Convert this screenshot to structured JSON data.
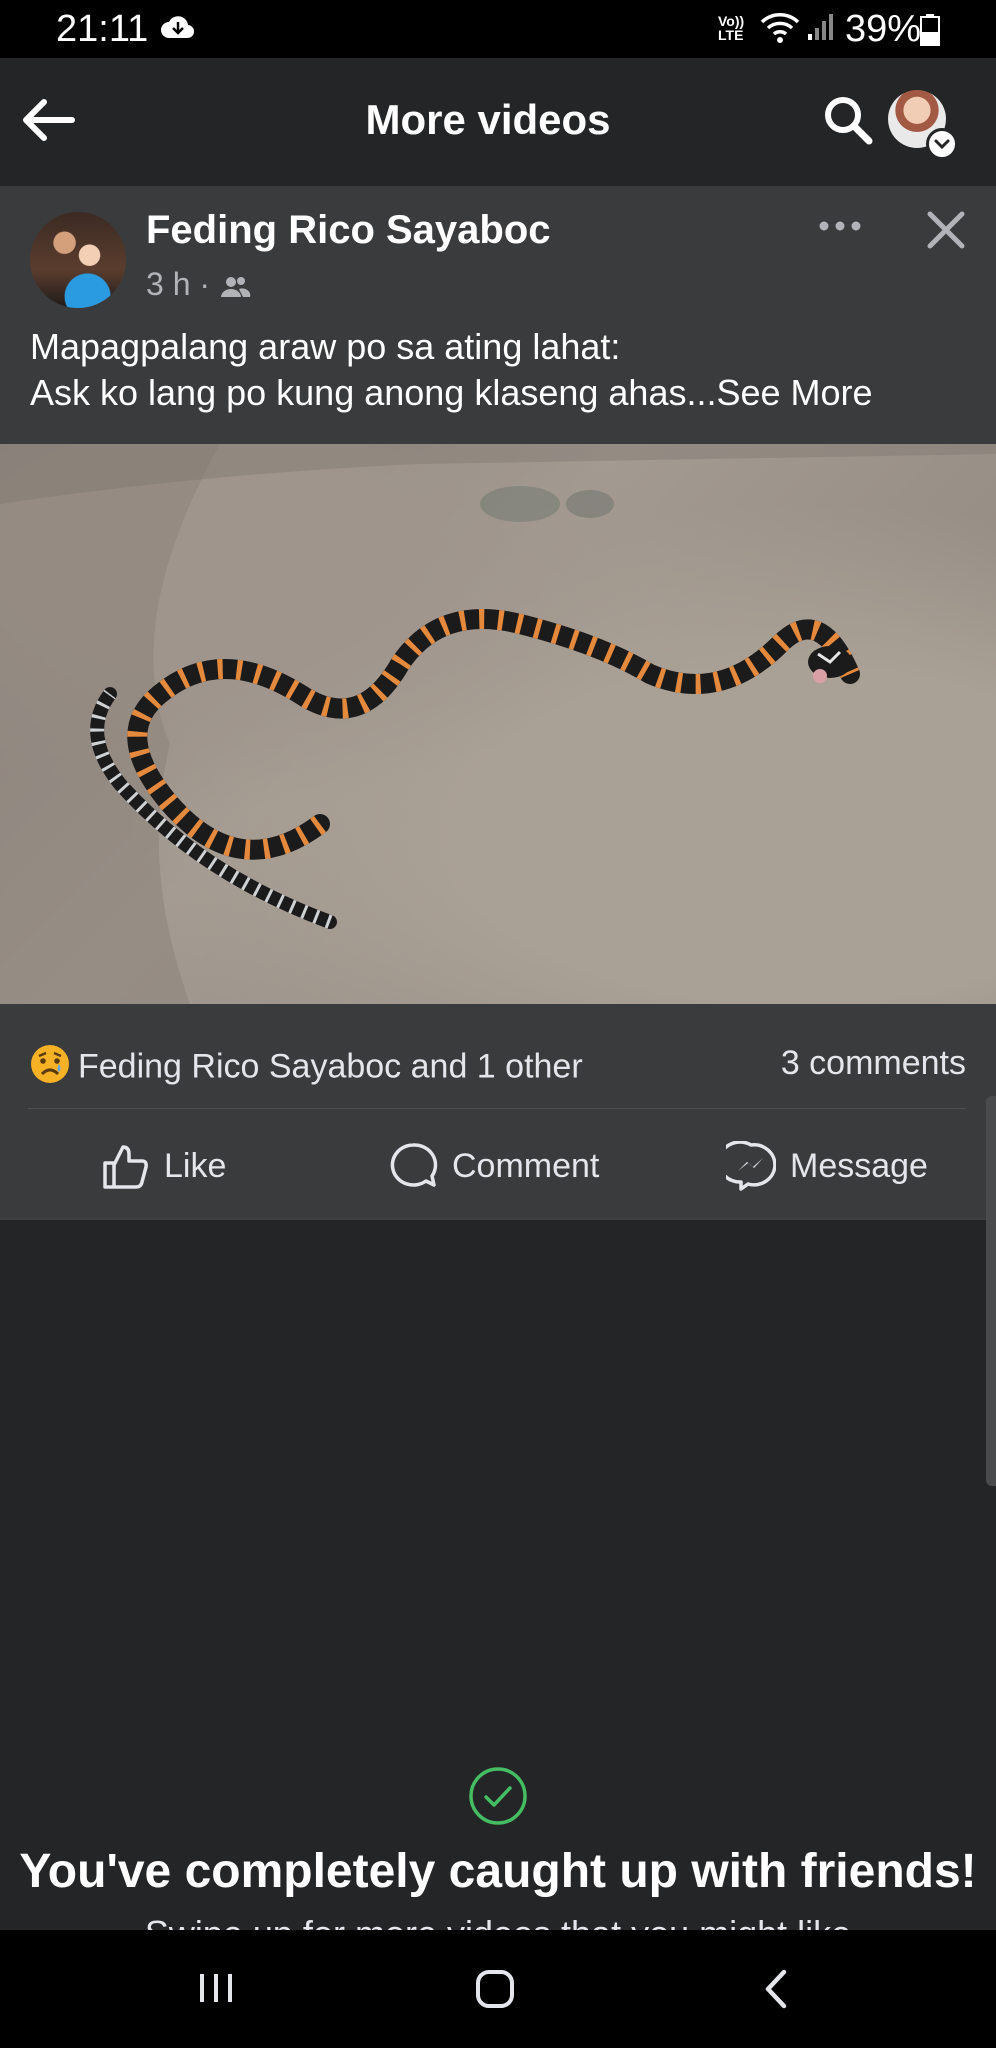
{
  "status_bar": {
    "time": "21:11",
    "volte_line1": "Vo))",
    "volte_line2": "LTE",
    "battery": "39%"
  },
  "header": {
    "title": "More videos"
  },
  "post": {
    "author": "Feding Rico Sayaboc",
    "time": "3 h",
    "separator": "·",
    "caption_line1": "Mapagpalang araw po sa ating lahat:",
    "caption_line2": "Ask ko lang po kung anong klaseng ahas...",
    "see_more": "See More",
    "reactions_text": "Feding Rico Sayaboc and 1 other",
    "comments_text": "3 comments",
    "actions": {
      "like": "Like",
      "comment": "Comment",
      "message": "Message"
    }
  },
  "caught_up": {
    "title": "You've completely caught up with friends!",
    "subtitle": "Swipe up for more videos that you might like"
  },
  "colors": {
    "background": "#242526",
    "card": "#3a3b3c",
    "check_green": "#45bd62"
  }
}
